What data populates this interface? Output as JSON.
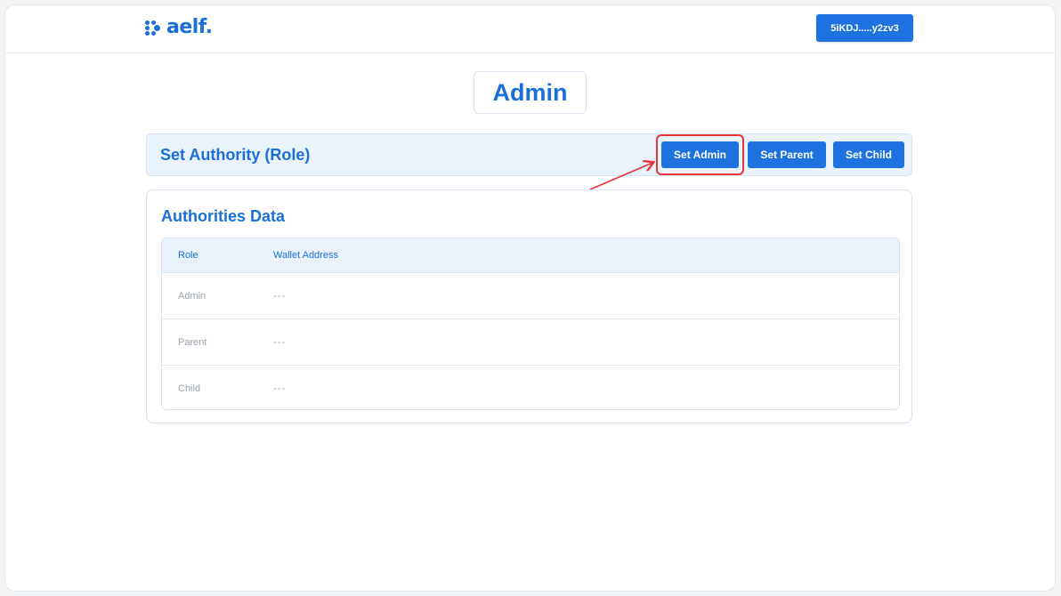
{
  "header": {
    "logo_text": "aelf.",
    "wallet_label": "5iKDJ.....y2zv3"
  },
  "page_title": "Admin",
  "authority": {
    "title": "Set Authority (Role)",
    "buttons": {
      "set_admin": "Set Admin",
      "set_parent": "Set Parent",
      "set_child": "Set Child"
    }
  },
  "authorities_data": {
    "title": "Authorities Data",
    "columns": {
      "role": "Role",
      "wallet": "Wallet Address"
    },
    "rows": [
      {
        "role": "Admin",
        "wallet": "---"
      },
      {
        "role": "Parent",
        "wallet": "---"
      },
      {
        "role": "Child",
        "wallet": "---"
      }
    ]
  },
  "colors": {
    "brand": "#1a6fd8",
    "button": "#1d72e0",
    "highlight": "#e5343b"
  }
}
